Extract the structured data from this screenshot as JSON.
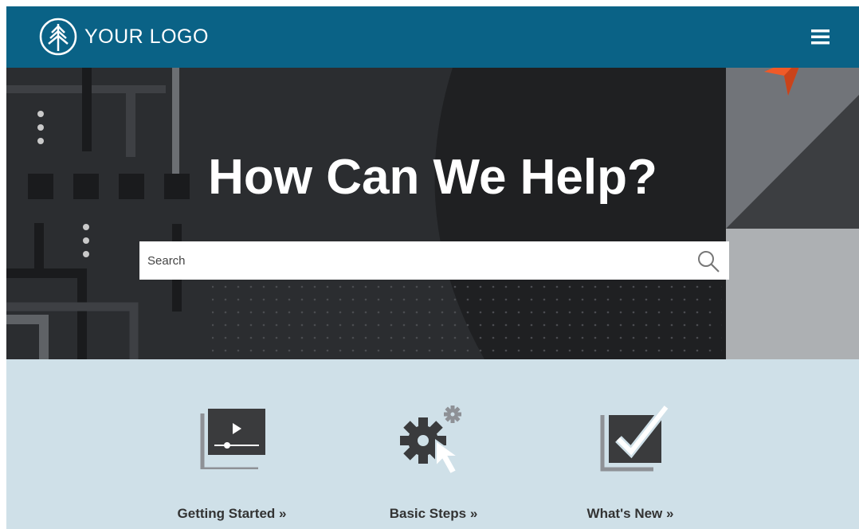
{
  "header": {
    "logo_text": "YOUR LOGO",
    "logo_icon": "tree-icon",
    "menu_icon": "hamburger-menu-icon",
    "background_color": "#0a6286",
    "pointer_icon": "orange-arrow-pointer-icon",
    "pointer_color": "#f05a28"
  },
  "hero": {
    "title": "How Can We Help?",
    "search_placeholder": "Search",
    "search_icon": "search-icon"
  },
  "tiles": [
    {
      "label": "Getting Started »",
      "icon": "video-player-icon"
    },
    {
      "label": "Basic Steps »",
      "icon": "gears-cursor-icon"
    },
    {
      "label": "What's New »",
      "icon": "checkbox-check-icon"
    }
  ],
  "colors": {
    "tiles_background": "#cfe0e8",
    "icon_dark": "#3a3b3d",
    "icon_gray": "#8e9196"
  }
}
